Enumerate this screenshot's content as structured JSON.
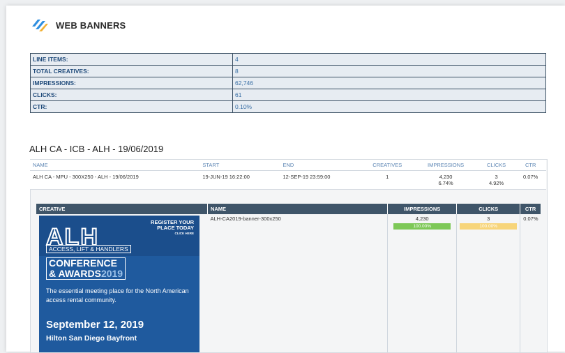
{
  "header": {
    "title": "WEB BANNERS",
    "icon": "web-banners-logo"
  },
  "summary": [
    {
      "label": "LINE ITEMS:",
      "value": "4"
    },
    {
      "label": "TOTAL CREATIVES:",
      "value": "8"
    },
    {
      "label": "IMPRESSIONS:",
      "value": "62,746"
    },
    {
      "label": "CLICKS:",
      "value": "61"
    },
    {
      "label": "CTR:",
      "value": "0.10%"
    }
  ],
  "line_item": {
    "title": "ALH CA - ICB - ALH - 19/06/2019",
    "headers": [
      "NAME",
      "START",
      "END",
      "CREATIVES",
      "IMPRESSIONS",
      "CLICKS",
      "CTR"
    ],
    "row": {
      "name": "ALH CA - MPU - 300X250 - ALH - 19/06/2019",
      "start": "19-JUN-19 16:22:00",
      "end": "12-SEP-19 23:59:00",
      "creatives": "1",
      "impressions": "4,230",
      "impressions_pct": "6.74%",
      "clicks": "3",
      "clicks_pct": "4.92%",
      "ctr": "0.07%"
    }
  },
  "creatives": {
    "headers": [
      "CREATIVE",
      "NAME",
      "IMPRESSIONS",
      "CLICKS",
      "CTR"
    ],
    "row": {
      "name": "ALH-CA2019-banner-300x250",
      "impressions": "4,230",
      "impressions_bar": "100.00%",
      "clicks": "3",
      "clicks_bar": "100.00%",
      "ctr": "0.07%"
    }
  },
  "banner": {
    "logo": "ALH",
    "register_line1": "REGISTER YOUR",
    "register_line2": "PLACE TODAY",
    "click_here": "CLICK HERE",
    "subtitle": "ACCESS, LIFT & HANDLERS",
    "conference": "CONFERENCE",
    "awards": "& AWARDS",
    "year": "2019",
    "description": "The essential meeting place for the North American access rental community.",
    "date": "September 12, 2019",
    "venue": "Hilton San Diego Bayfront"
  },
  "colors": {
    "accent_green": "#7dc857",
    "accent_yellow": "#f7d57a",
    "header_dark": "#3f5569",
    "banner_blue": "#1f5a9e"
  }
}
